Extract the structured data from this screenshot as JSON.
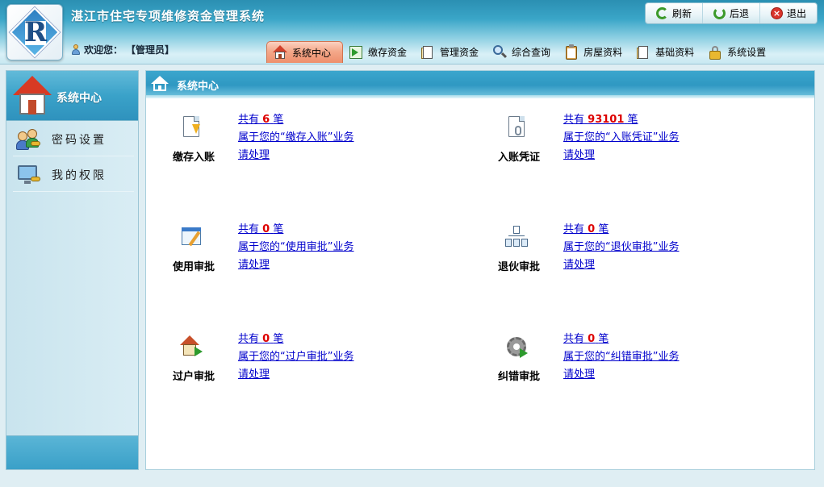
{
  "app": {
    "title": "湛江市住宅专项维修资金管理系统",
    "logo_letter": "R"
  },
  "user": {
    "welcome_label": "欢迎您：",
    "name": "【管理员】"
  },
  "top_actions": [
    {
      "label": "刷新",
      "icon": "refresh-icon"
    },
    {
      "label": "后退",
      "icon": "back-icon"
    },
    {
      "label": "退出",
      "icon": "exit-icon"
    }
  ],
  "nav": [
    {
      "label": "系统中心",
      "icon": "house-icon",
      "active": true
    },
    {
      "label": "缴存资金",
      "icon": "deposit-icon",
      "active": false
    },
    {
      "label": "管理资金",
      "icon": "manage-funds-icon",
      "active": false
    },
    {
      "label": "综合查询",
      "icon": "magnifier-icon",
      "active": false
    },
    {
      "label": "房屋资料",
      "icon": "clipboard-icon",
      "active": false
    },
    {
      "label": "基础资料",
      "icon": "base-data-icon",
      "active": false
    },
    {
      "label": "系统设置",
      "icon": "lock-icon",
      "active": false
    }
  ],
  "sidebar": {
    "header": "系统中心",
    "items": [
      {
        "label": "密码设置",
        "icon": "users-key-icon"
      },
      {
        "label": "我的权限",
        "icon": "monitor-key-icon"
      }
    ]
  },
  "main": {
    "title": "系统中心",
    "tasks": [
      {
        "label": "缴存入账",
        "prefix": "共有",
        "count": "6",
        "suffix": "笔",
        "desc": "属于您的“缴存入账”业务",
        "action": "请处理",
        "icon": "deposit-entry-icon"
      },
      {
        "label": "入账凭证",
        "prefix": "共有",
        "count": "93101",
        "suffix": "笔",
        "desc": "属于您的“入账凭证”业务",
        "action": "请处理",
        "icon": "voucher-icon"
      },
      {
        "label": "使用审批",
        "prefix": "共有",
        "count": "0",
        "suffix": "笔",
        "desc": "属于您的“使用审批”业务",
        "action": "请处理",
        "icon": "usage-approval-icon"
      },
      {
        "label": "退伙审批",
        "prefix": "共有",
        "count": "0",
        "suffix": "笔",
        "desc": "属于您的“退伙审批”业务",
        "action": "请处理",
        "icon": "withdrawal-approval-icon"
      },
      {
        "label": "过户审批",
        "prefix": "共有",
        "count": "0",
        "suffix": "笔",
        "desc": "属于您的“过户审批”业务",
        "action": "请处理",
        "icon": "transfer-approval-icon"
      },
      {
        "label": "纠错审批",
        "prefix": "共有",
        "count": "0",
        "suffix": "笔",
        "desc": "属于您的“纠错审批”业务",
        "action": "请处理",
        "icon": "correction-approval-icon"
      }
    ]
  },
  "colors": {
    "header_blue": "#2f98c2",
    "active_tab": "#ee8f6c",
    "link": "#0000cc",
    "count_red": "#dd0000"
  }
}
